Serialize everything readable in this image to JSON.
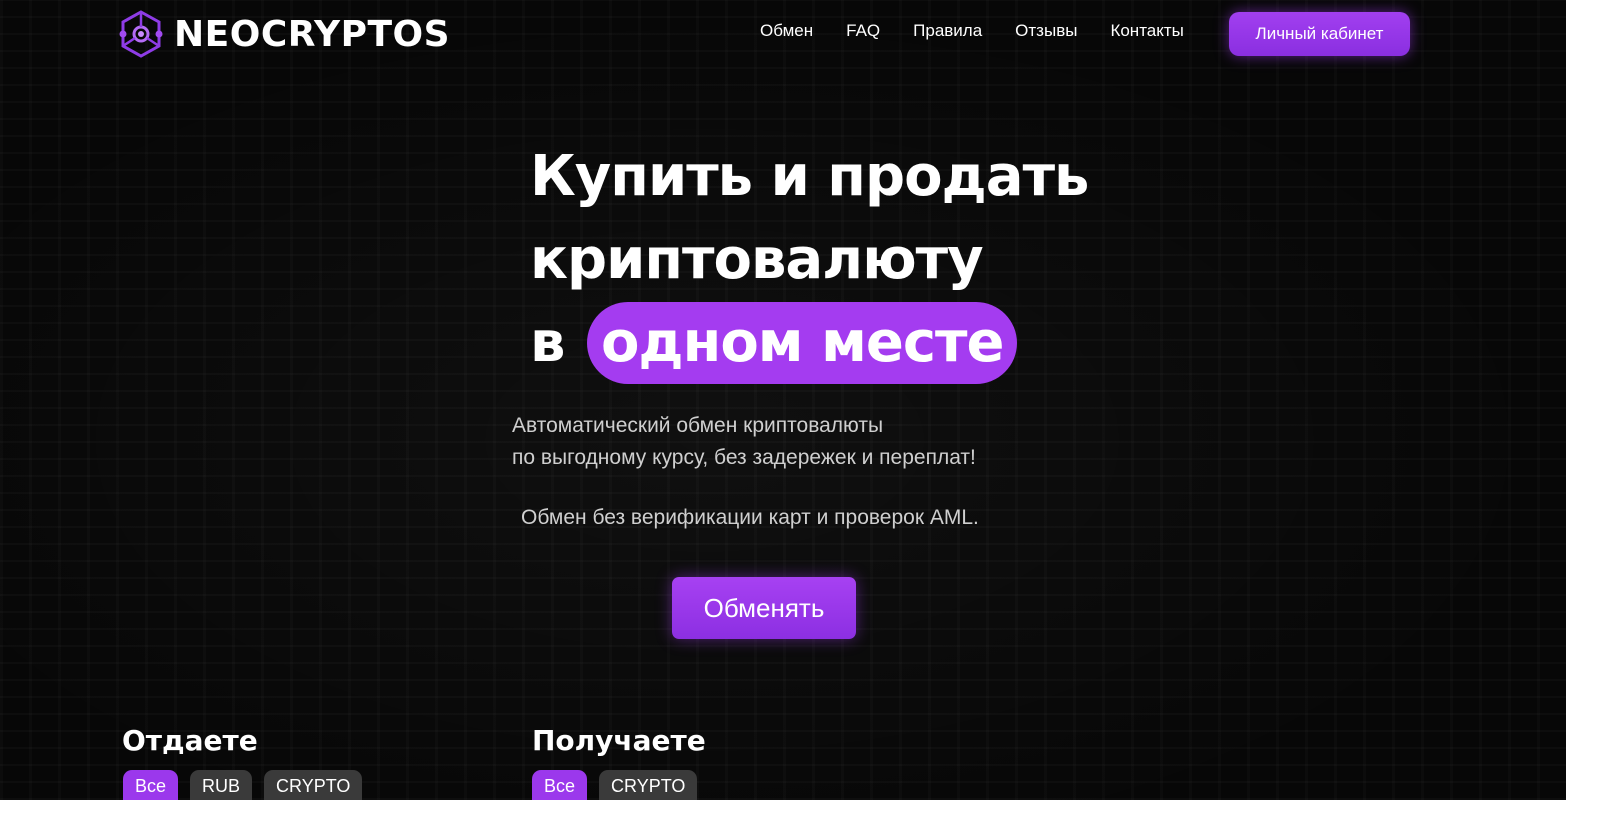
{
  "brand": {
    "name": "NEOCRYPTOS",
    "accent": "#a43cf0"
  },
  "nav": [
    {
      "label": "Обмен"
    },
    {
      "label": "FAQ"
    },
    {
      "label": "Правила"
    },
    {
      "label": "Отзывы"
    },
    {
      "label": "Контакты"
    }
  ],
  "header": {
    "cabinet_label": "Личный кабинет"
  },
  "hero": {
    "line1": "Купить и продать",
    "line2": "криптовалюту",
    "line3_prefix": "в",
    "line3_highlight": "одном месте",
    "subtitle_line1": "Автоматический обмен криптовалюты",
    "subtitle_line2": "по выгодному курсу, без задережек и переплат!",
    "note": "Обмен без верификации карт и проверок AML.",
    "cta_label": "Обменять"
  },
  "give": {
    "title": "Отдаете",
    "filters": [
      "Все",
      "RUB",
      "CRYPTO"
    ]
  },
  "receive": {
    "title": "Получаете",
    "filters": [
      "Все",
      "CRYPTO"
    ]
  },
  "icons": {
    "logo": "atom-network-icon"
  }
}
